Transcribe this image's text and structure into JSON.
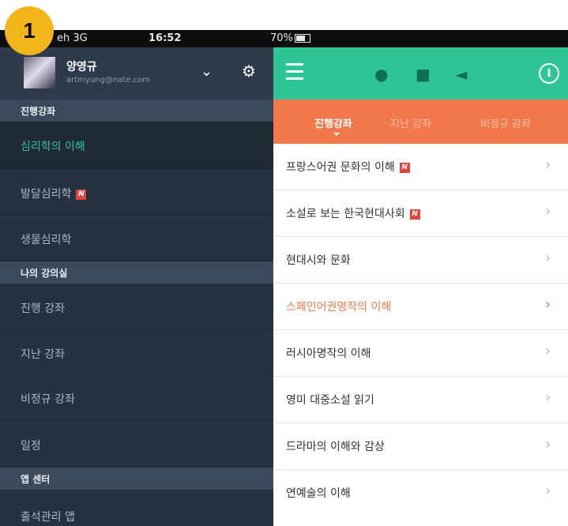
{
  "step_badge": "1",
  "status_bar": {
    "carrier": "eh 3G",
    "time": "16:52",
    "battery": "70%"
  },
  "profile": {
    "name": "양영규",
    "email": "artmyung@nate.com"
  },
  "drawer": {
    "section_current": "진행강좌",
    "current_items": [
      {
        "label": "심리학의 이해",
        "new": false
      },
      {
        "label": "발달심리학",
        "new": true
      },
      {
        "label": "생물심리학",
        "new": false
      }
    ],
    "section_mine": "나의 강의실",
    "mine_items": [
      "진행 강좌",
      "지난 강좌",
      "비정규 강좌",
      "일정"
    ],
    "section_apps": "앱 센터",
    "app_items": [
      "출석관리 앱"
    ]
  },
  "tabs": [
    "진행강좌",
    "지난 강좌",
    "비정규 강좌"
  ],
  "new_mark": "N",
  "courses": [
    {
      "label": "프랑스어권 문화의 이해",
      "new": true
    },
    {
      "label": "소설로 보는 한국현대사회",
      "new": true
    },
    {
      "label": "현대시와 문화",
      "new": false
    },
    {
      "label": "스페인어권명작의 이해",
      "new": false
    },
    {
      "label": "러시아명작의 이해",
      "new": false
    },
    {
      "label": "영미 대중소설 읽기",
      "new": false
    },
    {
      "label": "드라마의 이해와 감상",
      "new": false
    },
    {
      "label": "연예술의 이해",
      "new": false
    }
  ],
  "colors": {
    "accent_green": "#2ec495",
    "tab_orange": "#f2784b",
    "drawer_bg": "#263240",
    "highlight": "#ef7a4e",
    "new_red": "#e2453c"
  }
}
